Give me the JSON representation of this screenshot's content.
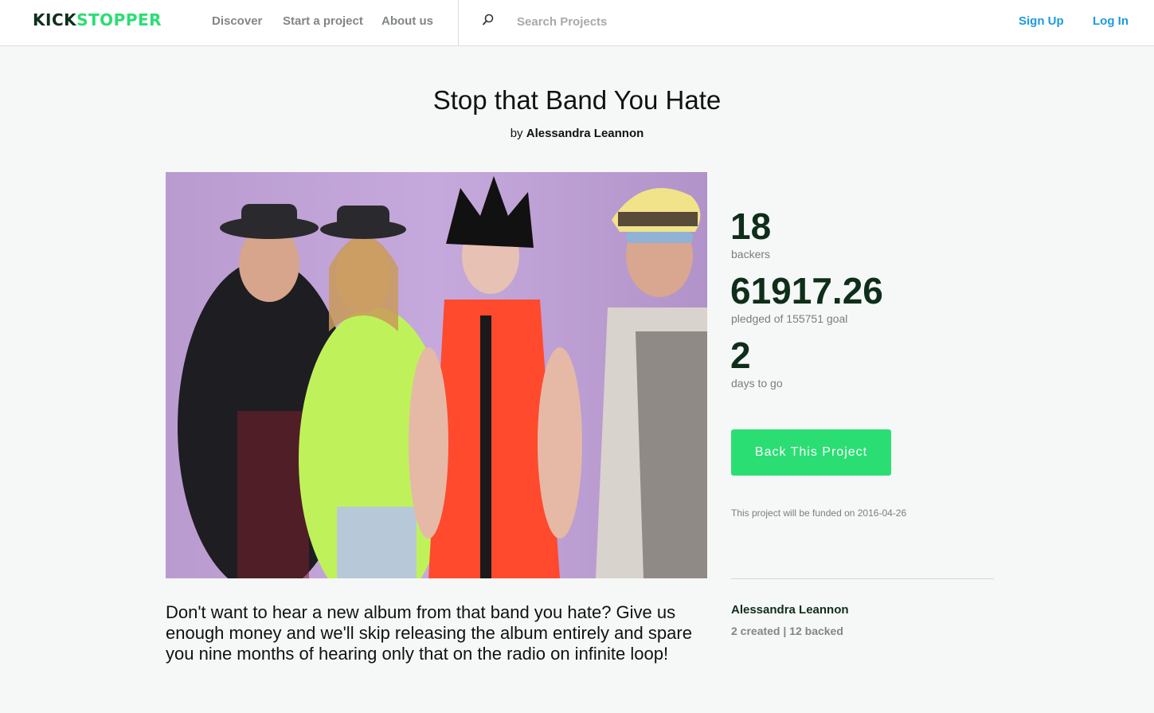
{
  "header": {
    "logo_part1": "KICK",
    "logo_part2": "STOPPER",
    "nav": {
      "discover": "Discover",
      "start_project": "Start a project",
      "about": "About us"
    },
    "search": {
      "placeholder": "Search Projects",
      "icon": "search-icon"
    },
    "auth": {
      "sign_up": "Sign Up",
      "log_in": "Log In"
    }
  },
  "project": {
    "title": "Stop that Band You Hate",
    "by_prefix": "by",
    "creator": "Alessandra Leannon",
    "description": "Don't want to hear a new album from that band you hate? Give us enough money and we'll skip releasing the album entirely and spare you nine months of hearing only that on the radio on infinite loop!"
  },
  "stats": {
    "backers_count": "18",
    "backers_label": "backers",
    "pledged_amount": "61917.26",
    "pledged_label": "pledged of 155751 goal",
    "days_count": "2",
    "days_label": "days to go"
  },
  "actions": {
    "back_button": "Back This Project",
    "funded_note": "This project will be funded on 2016-04-26"
  },
  "creator_card": {
    "name": "Alessandra Leannon",
    "stats": "2 created | 12 backed"
  },
  "colors": {
    "brand_green": "#2bde73",
    "brand_dark": "#0f2e1a",
    "link_blue": "#1a9be0",
    "muted_gray": "#828587"
  }
}
